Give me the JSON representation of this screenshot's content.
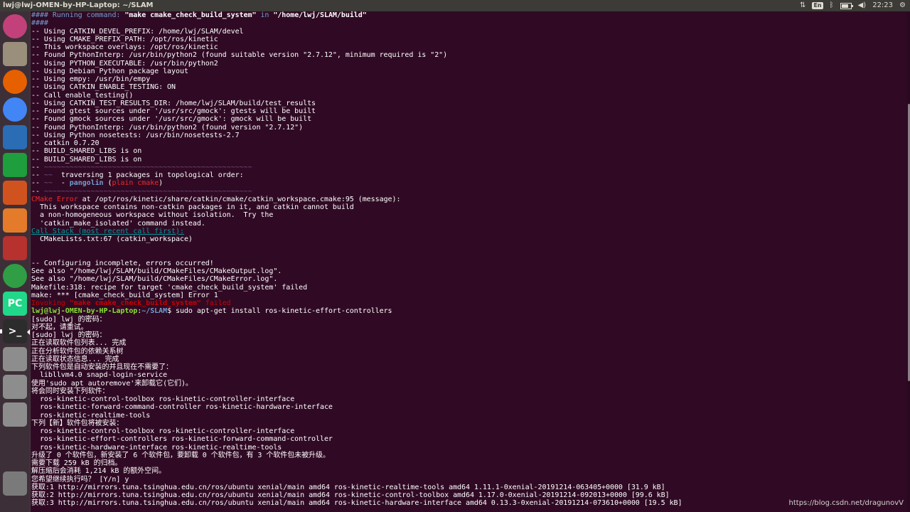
{
  "window": {
    "title": "lwj@lwj-OMEN-by-HP-Laptop: ~/SLAM"
  },
  "tray": {
    "keyboard": "En",
    "clock": "22:23",
    "icons": [
      "network-updown-icon",
      "keyboard-layout-icon",
      "bluetooth-icon",
      "battery-icon",
      "volume-icon",
      "gear-icon"
    ]
  },
  "launcher": {
    "items": [
      {
        "name": "ubuntu-dash-icon",
        "label": "",
        "color": "#c2417a"
      },
      {
        "name": "files-icon",
        "label": "",
        "color": "#9a8f7a"
      },
      {
        "name": "firefox-icon",
        "label": "",
        "color": "#e66000"
      },
      {
        "name": "chrome-icon",
        "label": "",
        "color": "#4285f4"
      },
      {
        "name": "writer-icon",
        "label": "",
        "color": "#2a6db5"
      },
      {
        "name": "calc-icon",
        "label": "",
        "color": "#1e9e3c"
      },
      {
        "name": "impress-icon",
        "label": "",
        "color": "#d0531f"
      },
      {
        "name": "software-center-icon",
        "label": "",
        "color": "#e37b2a"
      },
      {
        "name": "system-settings-icon",
        "label": "",
        "color": "#b7312e"
      },
      {
        "name": "update-icon",
        "label": "",
        "color": "#2f9e44"
      },
      {
        "name": "pycharm-icon",
        "label": "PC",
        "color": "#21d789"
      },
      {
        "name": "terminal-icon",
        "label": ">_",
        "color": "#2c2c2c"
      },
      {
        "name": "drive-icon",
        "label": "",
        "color": "#8d8d8d"
      },
      {
        "name": "drive-icon",
        "label": "",
        "color": "#8d8d8d"
      },
      {
        "name": "drive-icon",
        "label": "",
        "color": "#8d8d8d"
      },
      {
        "name": "trash-icon",
        "label": "",
        "color": "#7a7a7a"
      }
    ]
  },
  "terminal": {
    "lines": [
      [
        [
          "#### Running command: ",
          "blue"
        ],
        [
          "\"make cmake_check_build_system\"",
          "bold"
        ],
        [
          " in ",
          "blue"
        ],
        [
          "\"/home/lwj/SLAM/build\"",
          "bold"
        ]
      ],
      [
        [
          "####",
          "blue"
        ]
      ],
      [
        [
          "-- Using CATKIN_DEVEL_PREFIX: /home/lwj/SLAM/devel",
          ""
        ]
      ],
      [
        [
          "-- Using CMAKE_PREFIX_PATH: /opt/ros/kinetic",
          ""
        ]
      ],
      [
        [
          "-- This workspace overlays: /opt/ros/kinetic",
          ""
        ]
      ],
      [
        [
          "-- Found PythonInterp: /usr/bin/python2 (found suitable version \"2.7.12\", minimum required is \"2\")",
          ""
        ]
      ],
      [
        [
          "-- Using PYTHON_EXECUTABLE: /usr/bin/python2",
          ""
        ]
      ],
      [
        [
          "-- Using Debian Python package layout",
          ""
        ]
      ],
      [
        [
          "-- Using empy: /usr/bin/empy",
          ""
        ]
      ],
      [
        [
          "-- Using CATKIN_ENABLE_TESTING: ON",
          ""
        ]
      ],
      [
        [
          "-- Call enable_testing()",
          ""
        ]
      ],
      [
        [
          "-- Using CATKIN_TEST_RESULTS_DIR: /home/lwj/SLAM/build/test_results",
          ""
        ]
      ],
      [
        [
          "-- Found gtest sources under '/usr/src/gmock': gtests will be built",
          ""
        ]
      ],
      [
        [
          "-- Found gmock sources under '/usr/src/gmock': gmock will be built",
          ""
        ]
      ],
      [
        [
          "-- Found PythonInterp: /usr/bin/python2 (found version \"2.7.12\")",
          ""
        ]
      ],
      [
        [
          "-- Using Python nosetests: /usr/bin/nosetests-2.7",
          ""
        ]
      ],
      [
        [
          "-- catkin 0.7.20",
          ""
        ]
      ],
      [
        [
          "-- BUILD_SHARED_LIBS is on",
          ""
        ]
      ],
      [
        [
          "-- BUILD_SHARED_LIBS is on",
          ""
        ]
      ],
      [
        [
          "-- ",
          ""
        ],
        [
          "~~~~~~~~~~~~~~~~~~~~~~~~~~~~~~~~~~~~~~~~~~~~~~~~~",
          "dim"
        ]
      ],
      [
        [
          "-- ",
          ""
        ],
        [
          "~~",
          "dim"
        ],
        [
          "  traversing 1 packages in topological order:",
          ""
        ]
      ],
      [
        [
          "-- ",
          ""
        ],
        [
          "~~",
          "dim"
        ],
        [
          "  - ",
          ""
        ],
        [
          "pangolin",
          "bluebold"
        ],
        [
          " (",
          ""
        ],
        [
          "plain cmake",
          "red"
        ],
        [
          ")",
          ""
        ]
      ],
      [
        [
          "-- ",
          ""
        ],
        [
          "~~~~~~~~~~~~~~~~~~~~~~~~~~~~~~~~~~~~~~~~~~~~~~~~~",
          "dim"
        ]
      ],
      [
        [
          "CMake Error",
          "red"
        ],
        [
          " at /opt/ros/kinetic/share/catkin/cmake/catkin_workspace.cmake:95 (message):",
          ""
        ]
      ],
      [
        [
          "  This workspace contains non-catkin packages in it, and catkin cannot build",
          ""
        ]
      ],
      [
        [
          "  a non-homogeneous workspace without isolation.  Try the",
          ""
        ]
      ],
      [
        [
          "  'catkin_make_isolated' command instead.",
          ""
        ]
      ],
      [
        [
          "Call Stack (most recent call first):",
          "cyanul"
        ]
      ],
      [
        [
          "  CMakeLists.txt:67 (catkin_workspace)",
          ""
        ]
      ],
      [
        [
          "",
          ""
        ]
      ],
      [
        [
          "",
          ""
        ]
      ],
      [
        [
          "-- Configuring incomplete, errors occurred!",
          ""
        ]
      ],
      [
        [
          "See also \"/home/lwj/SLAM/build/CMakeFiles/CMakeOutput.log\".",
          ""
        ]
      ],
      [
        [
          "See also \"/home/lwj/SLAM/build/CMakeFiles/CMakeError.log\".",
          ""
        ]
      ],
      [
        [
          "Makefile:318: recipe for target 'cmake_check_build_system' failed",
          ""
        ]
      ],
      [
        [
          "make: *** [cmake_check_build_system] Error 1",
          ""
        ]
      ],
      [
        [
          "Invoking ",
          "dkred"
        ],
        [
          "\"make cmake_check_build_system\"",
          "dkredbold"
        ],
        [
          " failed",
          "dkred"
        ]
      ],
      [
        [
          "lwj@lwj-OMEN-by-HP-Laptop",
          "green"
        ],
        [
          ":",
          ""
        ],
        [
          "~/SLAM",
          "bluebold"
        ],
        [
          "$ sudo apt-get install ros-kinetic-effort-controllers",
          ""
        ]
      ],
      [
        [
          "[sudo] lwj 的密码：",
          ""
        ]
      ],
      [
        [
          "对不起，请重试。",
          ""
        ]
      ],
      [
        [
          "[sudo] lwj 的密码：",
          ""
        ]
      ],
      [
        [
          "正在读取软件包列表... 完成",
          ""
        ]
      ],
      [
        [
          "正在分析软件包的依赖关系树",
          ""
        ]
      ],
      [
        [
          "正在读取状态信息... 完成",
          ""
        ]
      ],
      [
        [
          "下列软件包是自动安装的并且现在不需要了：",
          ""
        ]
      ],
      [
        [
          "  libllvm4.0 snapd-login-service",
          ""
        ]
      ],
      [
        [
          "使用'sudo apt autoremove'来卸载它(它们)。",
          ""
        ]
      ],
      [
        [
          "将会同时安装下列软件：",
          ""
        ]
      ],
      [
        [
          "  ros-kinetic-control-toolbox ros-kinetic-controller-interface",
          ""
        ]
      ],
      [
        [
          "  ros-kinetic-forward-command-controller ros-kinetic-hardware-interface",
          ""
        ]
      ],
      [
        [
          "  ros-kinetic-realtime-tools",
          ""
        ]
      ],
      [
        [
          "下列【新】软件包将被安装：",
          ""
        ]
      ],
      [
        [
          "  ros-kinetic-control-toolbox ros-kinetic-controller-interface",
          ""
        ]
      ],
      [
        [
          "  ros-kinetic-effort-controllers ros-kinetic-forward-command-controller",
          ""
        ]
      ],
      [
        [
          "  ros-kinetic-hardware-interface ros-kinetic-realtime-tools",
          ""
        ]
      ],
      [
        [
          "升级了 0 个软件包，新安装了 6 个软件包，要卸载 0 个软件包，有 3 个软件包未被升级。",
          ""
        ]
      ],
      [
        [
          "需要下载 259 kB 的归档。",
          ""
        ]
      ],
      [
        [
          "解压缩后会消耗 1,214 kB 的额外空间。",
          ""
        ]
      ],
      [
        [
          "您希望继续执行吗？ [Y/n] y",
          ""
        ]
      ],
      [
        [
          "获取:1 http://mirrors.tuna.tsinghua.edu.cn/ros/ubuntu xenial/main amd64 ros-kinetic-realtime-tools amd64 1.11.1-0xenial-20191214-063405+0000 [31.9 kB]",
          ""
        ]
      ],
      [
        [
          "获取:2 http://mirrors.tuna.tsinghua.edu.cn/ros/ubuntu xenial/main amd64 ros-kinetic-control-toolbox amd64 1.17.0-0xenial-20191214-092013+0000 [99.6 kB]",
          ""
        ]
      ],
      [
        [
          "获取:3 http://mirrors.tuna.tsinghua.edu.cn/ros/ubuntu xenial/main amd64 ros-kinetic-hardware-interface amd64 0.13.3-0xenial-20191214-073610+0000 [19.5 kB]",
          ""
        ]
      ]
    ]
  },
  "watermark": "https://blog.csdn.net/dragunovV"
}
